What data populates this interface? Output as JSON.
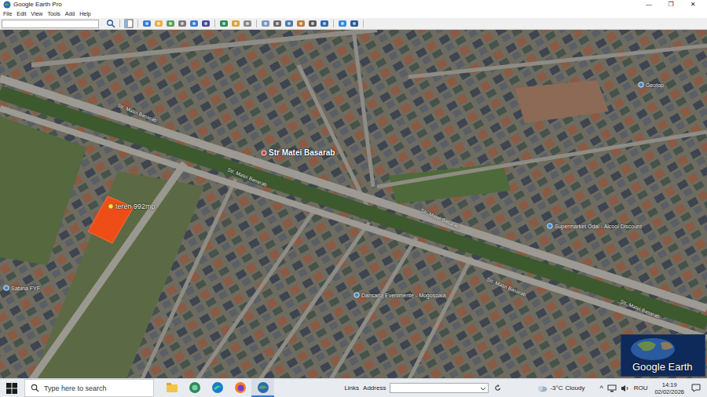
{
  "window": {
    "title": "Google Earth Pro",
    "controls": [
      "—",
      "❐",
      "✕"
    ]
  },
  "menu": [
    "File",
    "Edit",
    "View",
    "Tools",
    "Add",
    "Help"
  ],
  "map": {
    "labels": [
      {
        "text": "Str Matei Basarab",
        "kind": "place"
      },
      {
        "text": "teren 992mp",
        "kind": "placemark"
      },
      {
        "text": "Supermarket Odai - Alcool Discount",
        "kind": "poi"
      },
      {
        "text": "Sabina FYF",
        "kind": "poi"
      },
      {
        "text": "Dansaroj Evenimente - Mogosoaia",
        "kind": "poi"
      },
      {
        "text": "Geotop",
        "kind": "poi"
      },
      {
        "text": "Str. Matei Basarab",
        "kind": "street"
      },
      {
        "text": "Str. Matei Basarab",
        "kind": "street"
      },
      {
        "text": "Str. Matei Basarab",
        "kind": "street"
      },
      {
        "text": "Str. Matei Basarab",
        "kind": "street"
      },
      {
        "text": "Str. Matei Basarab",
        "kind": "street"
      }
    ],
    "logo": "Google Earth"
  },
  "taskbar": {
    "search_placeholder": "Type here to search",
    "apps": [
      {
        "kind": "folder",
        "active": false
      },
      {
        "kind": "edge-dev",
        "active": false
      },
      {
        "kind": "edge",
        "active": false
      },
      {
        "kind": "firefox",
        "active": false
      },
      {
        "kind": "earth",
        "active": true
      }
    ],
    "links": "Links",
    "address_label": "Address",
    "weather": {
      "temp": "-3°C",
      "condition": "Cloudy"
    },
    "tray_arrow": "^",
    "language": "ROU",
    "time": "14:19",
    "date": "02/02/2026"
  }
}
